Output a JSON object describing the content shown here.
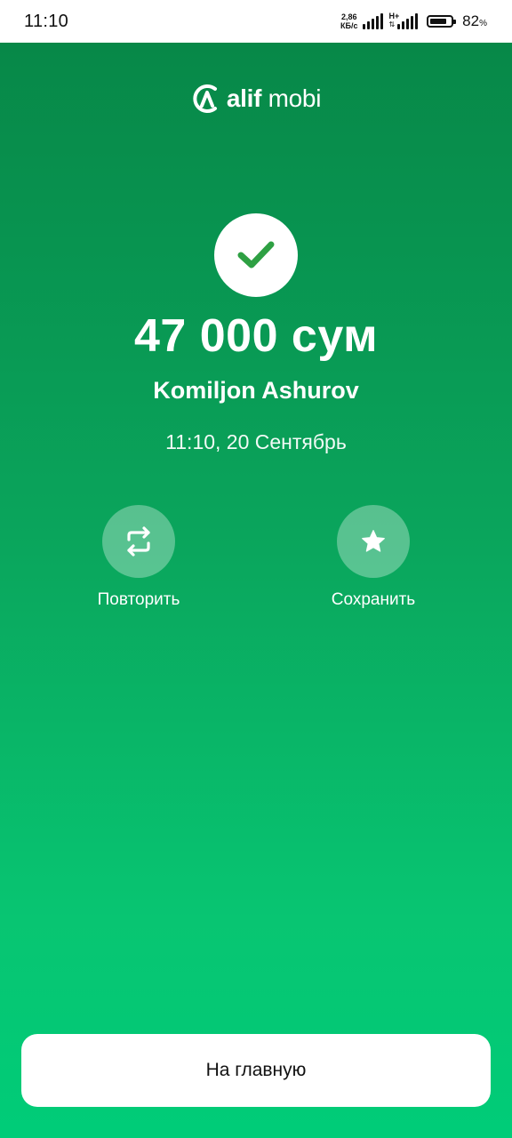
{
  "status_bar": {
    "time": "11:10",
    "net_speed_value": "2,86",
    "net_speed_unit": "КБ/с",
    "network_type": "H+",
    "battery_percent": "82",
    "battery_percent_sign": "%",
    "battery_level": 0.82
  },
  "logo": {
    "brand_bold": "alif",
    "brand_light": " mobi",
    "icon": "alif-logo-icon"
  },
  "result": {
    "status_icon": "check-icon",
    "accent_color": "#2ea043",
    "amount": "47 000 сум",
    "recipient": "Komiljon Ashurov",
    "datetime": "11:10, 20 Сентябрь"
  },
  "actions": {
    "repeat_label": "Повторить",
    "repeat_icon": "repeat-icon",
    "save_label": "Сохранить",
    "save_icon": "star-icon"
  },
  "footer": {
    "home_button_label": "На главную"
  },
  "colors": {
    "background_top": "#078848",
    "background_bottom": "#00cc78",
    "button_bg": "#ffffff"
  }
}
